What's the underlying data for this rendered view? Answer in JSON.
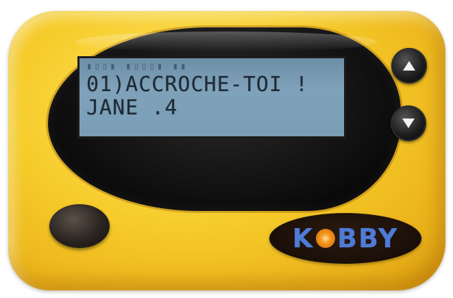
{
  "lcd": {
    "status_row": "▮▯▯▮ ▮▯▯▯▮ ▮▮",
    "line1": "01)ACCROCHE-TOI !",
    "line2": "JANE .4"
  },
  "logo": {
    "text_before": "K",
    "text_after": "BBY"
  },
  "colors": {
    "body": "#f6cc2a",
    "lcd": "#7a9eb6",
    "logo_text": "#4f7bd6",
    "logo_dot": "#f49b1e"
  },
  "icons": {
    "up": "triangle-up-icon",
    "down": "triangle-down-icon"
  }
}
